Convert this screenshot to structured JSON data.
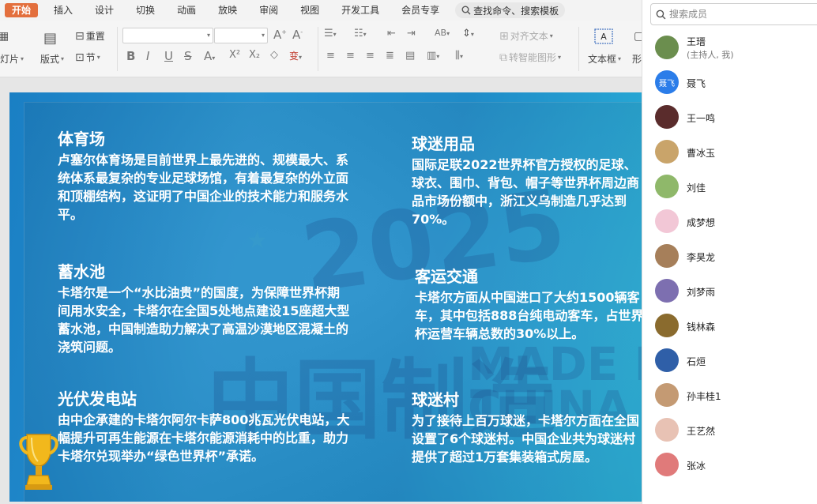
{
  "menu": {
    "items": [
      "开始",
      "插入",
      "设计",
      "切换",
      "动画",
      "放映",
      "审阅",
      "视图",
      "开发工具",
      "会员专享"
    ],
    "search_label": "查找命令、搜索模板"
  },
  "toolbar": {
    "reset": "重置",
    "slideshow": "幻灯片",
    "layout": "版式",
    "section": "节",
    "align_text": "对齐文本",
    "smartart": "转智能图形",
    "textbox": "文本框",
    "shape": "形"
  },
  "slide": {
    "blocks": [
      {
        "title": "体育场",
        "body": "卢塞尔体育场是目前世界上最先进的、规模最大、系统体系最复杂的专业足球场馆，有着最复杂的外立面和顶棚结构，这证明了中国企业的技术能力和服务水平。"
      },
      {
        "title": "蓄水池",
        "body": "卡塔尔是一个“水比油贵”的国度，为保障世界杯期间用水安全，卡塔尔在全国5处地点建设15座超大型蓄水池，中国制造助力解决了高温沙漠地区混凝土的浇筑问题。"
      },
      {
        "title": "光伏发电站",
        "body": "由中企承建的卡塔尔阿尔卡萨800兆瓦光伏电站，大幅提升可再生能源在卡塔尔能源消耗中的比重，助力卡塔尔兑现举办“绿色世界杯”承诺。"
      },
      {
        "title": "球迷用品",
        "body": "国际足联2022世界杯官方授权的足球、球衣、围巾、背包、帽子等世界杯周边商品市场份额中，浙江义乌制造几乎达到70%。"
      },
      {
        "title": "客运交通",
        "body": "卡塔尔方面从中国进口了大约1500辆客车，其中包括888台纯电动客车，占世界杯运营车辆总数的30%以上。"
      },
      {
        "title": "球迷村",
        "body": "为了接待上百万球迷，卡塔尔方面在全国设置了6个球迷村。中国企业共为球迷村提供了超过1万套集装箱式房屋。"
      }
    ]
  },
  "panel": {
    "search_placeholder": "搜索成员",
    "members": [
      {
        "name": "王瑨",
        "sub": "(主持人, 我)",
        "color": "#6b8e4e"
      },
      {
        "name": "聂飞",
        "sub": "",
        "color": "#2b7de9",
        "initials": "聂飞"
      },
      {
        "name": "王一鸣",
        "sub": "",
        "color": "#5a2c2c"
      },
      {
        "name": "曹冰玉",
        "sub": "",
        "color": "#c9a46a"
      },
      {
        "name": "刘佳",
        "sub": "",
        "color": "#8fb86a"
      },
      {
        "name": "成梦想",
        "sub": "",
        "color": "#f2c7d6"
      },
      {
        "name": "李昊龙",
        "sub": "",
        "color": "#a67f5a"
      },
      {
        "name": "刘梦雨",
        "sub": "",
        "color": "#7d6fb0"
      },
      {
        "name": "钱林森",
        "sub": "",
        "color": "#8a6b2e"
      },
      {
        "name": "石烜",
        "sub": "",
        "color": "#2f5fa8"
      },
      {
        "name": "孙丰桂1",
        "sub": "",
        "color": "#c49a73"
      },
      {
        "name": "王艺然",
        "sub": "",
        "color": "#e8c2b4"
      },
      {
        "name": "张冰",
        "sub": "",
        "color": "#e07a7a"
      }
    ]
  }
}
